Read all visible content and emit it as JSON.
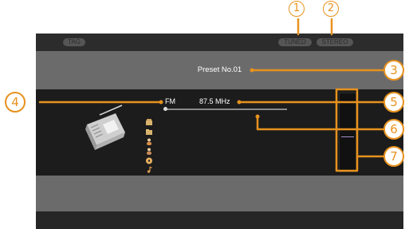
{
  "header": {
    "tag_label": "TAG",
    "tuned_label": "TUNED",
    "stereo_label": "STEREO"
  },
  "preset": {
    "text": "Preset No.01"
  },
  "tuner": {
    "band": "FM",
    "frequency": "87.5 MHz",
    "position": 0.0
  },
  "callouts": [
    "1",
    "2",
    "3",
    "4",
    "5",
    "6",
    "7"
  ],
  "colors": {
    "accent": "#e8921e",
    "screen_bg": "#6b6b6b",
    "panel_bg": "#1c1c1c",
    "bar_bg": "#2c2c2c",
    "meter_mark": "#a78cc9"
  },
  "icons": [
    "radio-icon",
    "album-icon",
    "folder-icon",
    "artist-icon",
    "disc-icon",
    "music-note-icon"
  ]
}
